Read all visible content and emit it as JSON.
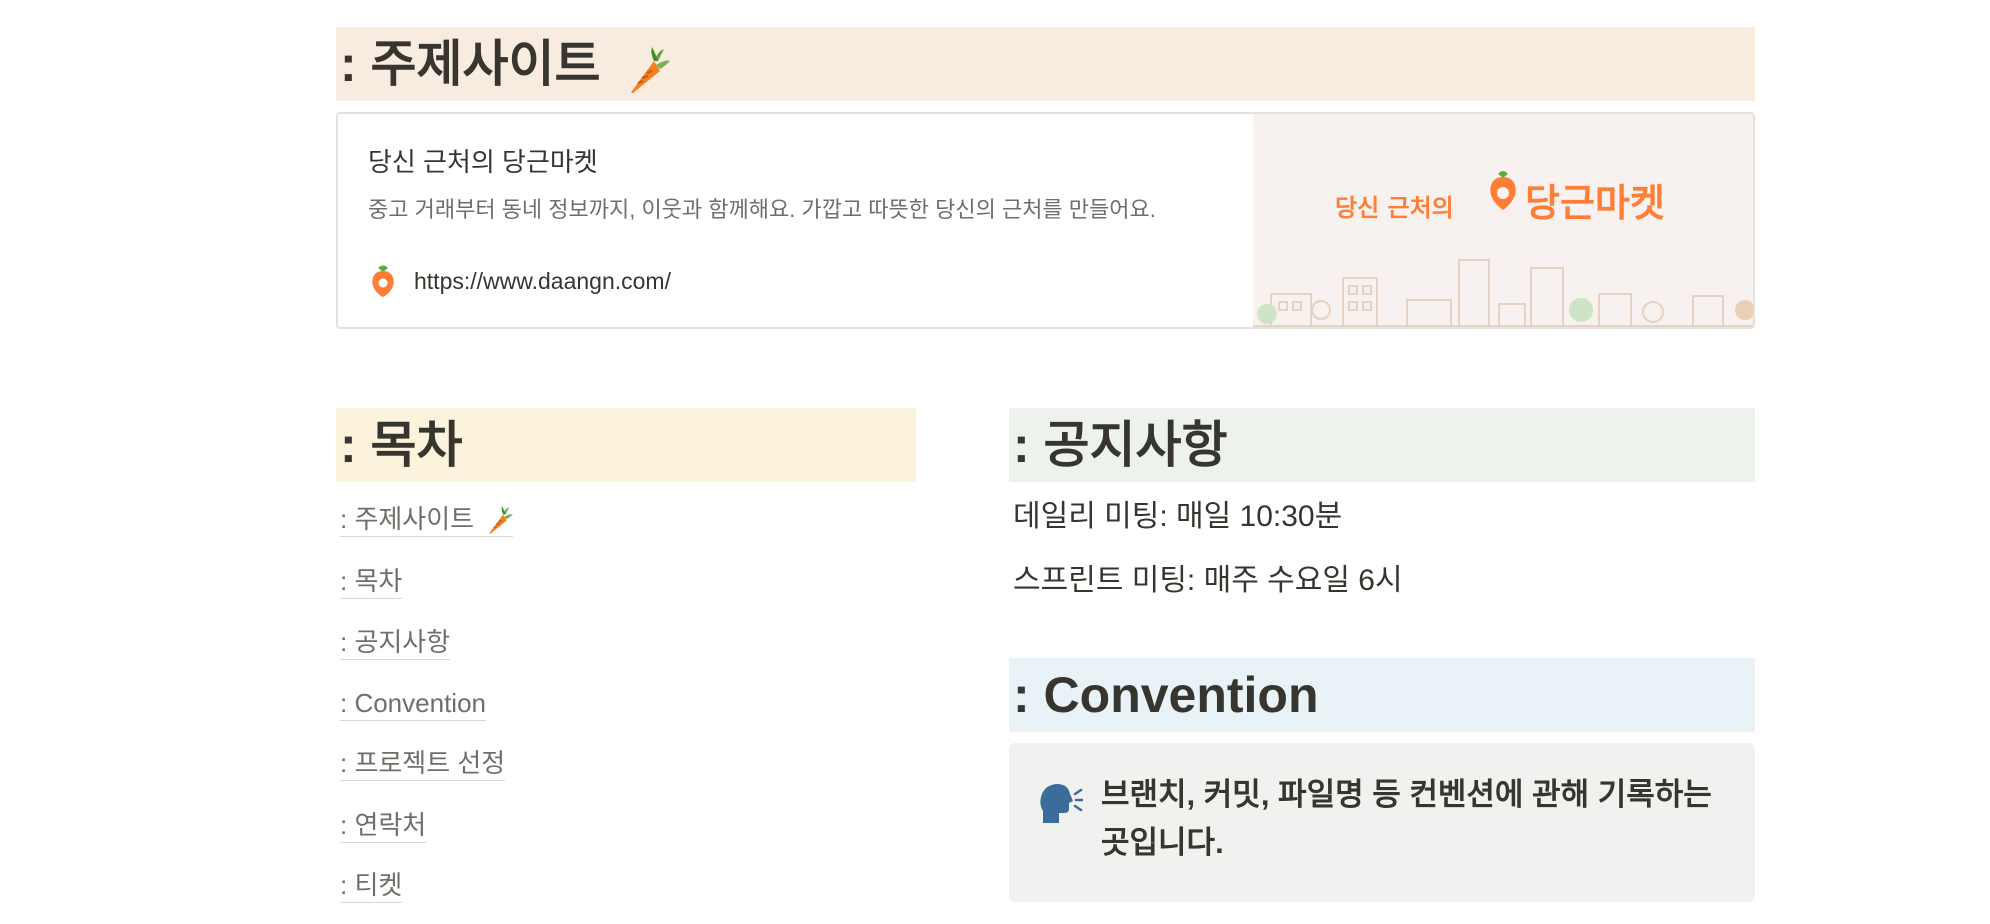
{
  "headings": {
    "site": ": 주제사이트",
    "toc": ": 목차",
    "notice": ": 공지사항",
    "convention": ": Convention"
  },
  "bookmark": {
    "title": "당신 근처의 당근마켓",
    "description": "중고 거래부터 동네 정보까지, 이웃과 함께해요. 가깝고 따뜻한 당신의 근처를 만들어요.",
    "url": "https://www.daangn.com/",
    "banner_prefix": "당신 근처의",
    "banner_brand": "당근마켓"
  },
  "toc": {
    "items": [
      {
        "label": ": 주제사이트",
        "icon": "carrot-icon"
      },
      {
        "label": ": 목차"
      },
      {
        "label": ": 공지사항"
      },
      {
        "label": ": Convention"
      },
      {
        "label": ": 프로젝트 선정"
      },
      {
        "label": ": 연락처"
      },
      {
        "label": ": 티켓"
      }
    ]
  },
  "notice": {
    "lines": [
      "데일리 미팅: 매일 10:30분",
      "스프린트 미팅: 매주 수요일 6시"
    ]
  },
  "callout": {
    "icon": "speaking-head-icon",
    "text": "브랜치, 커밋, 파일명 등 컨벤션에 관해 기록하는 곳입니다."
  },
  "colors": {
    "brand_orange": "#ff7e36",
    "heading_site_bg": "#f8ebdf",
    "heading_toc_bg": "#fbf3db",
    "heading_notice_bg": "#edf3ec",
    "heading_convention_bg": "#e9f2f7",
    "callout_bg": "#f1f1ef"
  }
}
